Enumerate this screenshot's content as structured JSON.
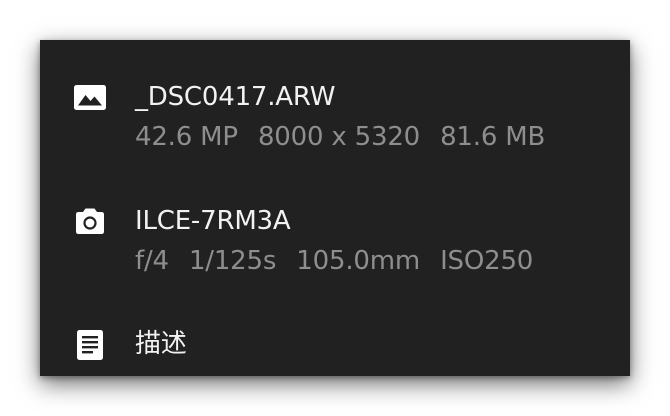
{
  "file": {
    "icon": "image-icon",
    "name": "_DSC0417.ARW",
    "details": [
      "42.6 MP",
      "8000 x 5320",
      "81.6 MB"
    ]
  },
  "camera": {
    "icon": "camera-icon",
    "model": "ILCE-7RM3A",
    "settings": [
      "f/4",
      "1/125s",
      "105.0mm",
      "ISO250"
    ]
  },
  "description": {
    "icon": "document-icon",
    "label": "描述"
  },
  "colors": {
    "panel_background": "#212121",
    "primary_text": "#f2f2f2",
    "secondary_text": "#8e8e8e"
  }
}
